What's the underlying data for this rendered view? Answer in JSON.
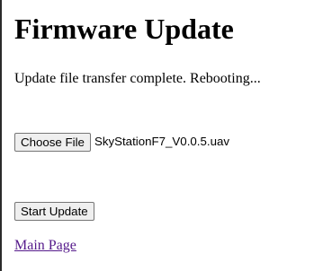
{
  "page": {
    "title": "Firmware Update",
    "status_message": "Update file transfer complete. Rebooting..."
  },
  "file_input": {
    "button_label": "Choose File",
    "selected_file": "SkyStationF7_V0.0.5.uav"
  },
  "actions": {
    "start_update_label": "Start Update"
  },
  "links": {
    "main_page_label": "Main Page"
  },
  "colors": {
    "visited_link": "#551a8b",
    "button_background": "#efefef",
    "button_border": "#767676"
  }
}
